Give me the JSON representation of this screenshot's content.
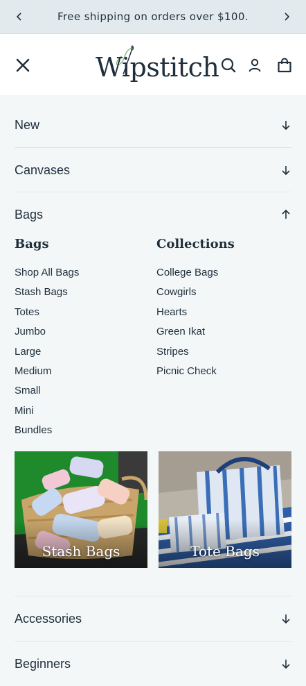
{
  "announcement": {
    "text": "Free shipping on orders over $100."
  },
  "header": {
    "logo_text": "Wipstitch"
  },
  "menu": {
    "new": "New",
    "canvases": "Canvases",
    "bags": "Bags",
    "accessories": "Accessories",
    "beginners": "Beginners"
  },
  "bags_panel": {
    "bags_title": "Bags",
    "collections_title": "Collections",
    "bags_links": [
      "Shop All Bags",
      "Stash Bags",
      "Totes",
      "Jumbo",
      "Large",
      "Medium",
      "Small",
      "Mini",
      "Bundles"
    ],
    "collections_links": [
      "College Bags",
      "Cowgirls",
      "Hearts",
      "Green Ikat",
      "Stripes",
      "Picnic Check"
    ],
    "promos": [
      {
        "caption": "Stash Bags"
      },
      {
        "caption": "Tote Bags"
      }
    ]
  },
  "colors": {
    "text": "#1f2f3c",
    "background": "#f4f7f8",
    "announcement_bg": "#e2eaee"
  }
}
